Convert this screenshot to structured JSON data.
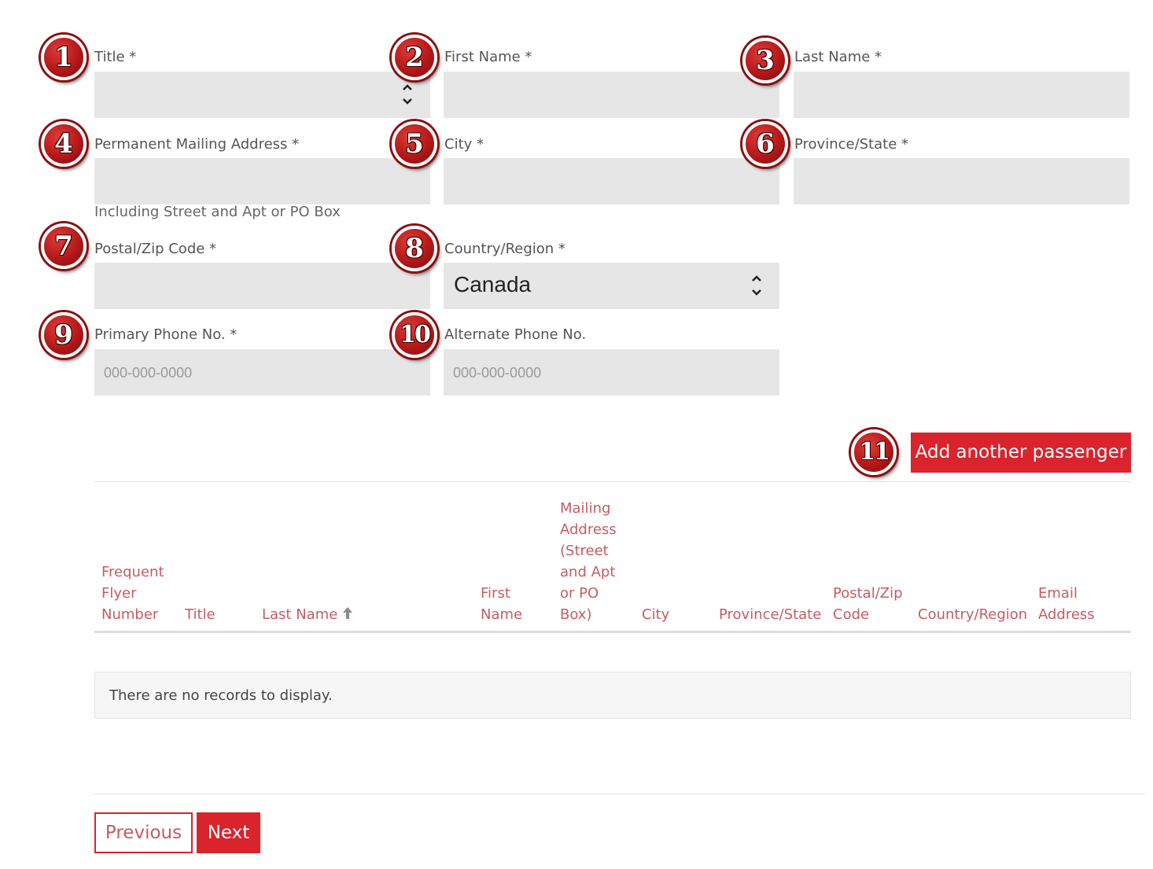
{
  "form": {
    "title_label": "Title *",
    "first_name_label": "First Name *",
    "last_name_label": "Last Name *",
    "address_label": "Permanent Mailing Address *",
    "address_hint": "Including Street and Apt or PO Box",
    "city_label": "City *",
    "province_label": "Province/State *",
    "postal_label": "Postal/Zip Code *",
    "country_label": "Country/Region *",
    "country_value": "Canada",
    "primary_phone_label": "Primary Phone No. *",
    "primary_phone_placeholder": "000-000-0000",
    "alternate_phone_label": "Alternate Phone No.",
    "alternate_phone_placeholder": "000-000-0000"
  },
  "badges": [
    "1",
    "2",
    "3",
    "4",
    "5",
    "6",
    "7",
    "8",
    "9",
    "10",
    "11"
  ],
  "add_passenger_label": "Add another passenger",
  "table": {
    "headers": {
      "frequent_flyer": [
        "Frequent",
        "Flyer",
        "Number"
      ],
      "title": [
        "Title"
      ],
      "last_name": [
        "Last Name"
      ],
      "first_name": [
        "First",
        "Name"
      ],
      "mailing_address": [
        "Mailing",
        "Address",
        "(Street",
        "and Apt",
        "or PO",
        "Box)"
      ],
      "city": [
        "City"
      ],
      "province": [
        "Province/State"
      ],
      "postal": [
        "Postal/Zip",
        "Code"
      ],
      "country": [
        "Country/Region"
      ],
      "email": [
        "Email",
        "Address"
      ]
    },
    "empty_message": "There are no records to display."
  },
  "nav": {
    "previous_label": "Previous",
    "next_label": "Next"
  },
  "colors": {
    "accent": "#d9232d",
    "header_text": "#c65c63",
    "field_bg": "#e6e6e6",
    "badge": "#b41818"
  }
}
